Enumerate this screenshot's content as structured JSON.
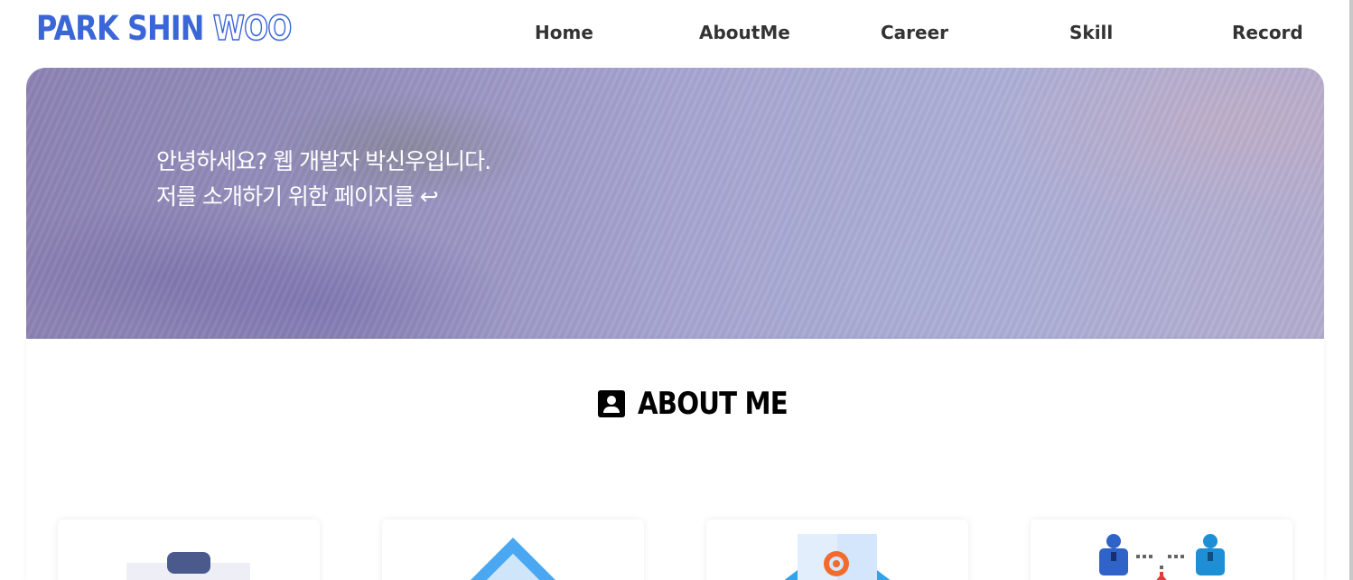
{
  "header": {
    "logo_main": "PARK SHIN",
    "logo_accent": "WOO",
    "nav": [
      {
        "label": "Home"
      },
      {
        "label": "AboutMe"
      },
      {
        "label": "Career"
      },
      {
        "label": "Skill"
      },
      {
        "label": "Record"
      }
    ]
  },
  "hero": {
    "line1": "안녕하세요? 웹 개발자 박신우입니다.",
    "line2": "저를 소개하기 위한 페이지를 ↩"
  },
  "about": {
    "title": "ABOUT ME",
    "title_icon": "person-badge-icon",
    "cards": [
      {
        "icon": "clipboard-icon"
      },
      {
        "icon": "home-icon"
      },
      {
        "icon": "email-icon"
      },
      {
        "icon": "people-network-icon"
      }
    ]
  },
  "colors": {
    "brand": "#3a66d8",
    "nav_text": "#333333",
    "hero_text": "#ffffff"
  }
}
